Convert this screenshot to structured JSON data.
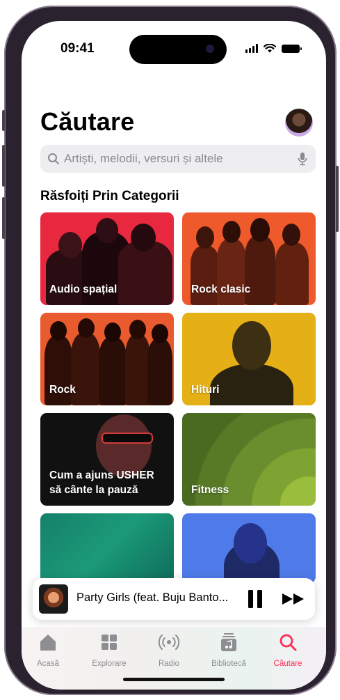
{
  "status": {
    "time": "09:41"
  },
  "header": {
    "title": "Căutare"
  },
  "search": {
    "placeholder": "Artiști, melodii, versuri și altele"
  },
  "section": {
    "title": "Răsfoiți Prin Categorii"
  },
  "categories": [
    {
      "label": "Audio spațial",
      "color": "#e8283f"
    },
    {
      "label": "Rock clasic",
      "color": "#ef5a2c"
    },
    {
      "label": "Rock",
      "color": "#e95a2e"
    },
    {
      "label": "Hituri",
      "color": "#e4b016"
    },
    {
      "label": "Cum a ajuns USHER să cânte la pauză",
      "color": "#111111"
    },
    {
      "label": "Fitness",
      "color": "#6a8d2e"
    },
    {
      "label": "",
      "color": "#1b8a6d"
    },
    {
      "label": "",
      "color": "#4f7bea"
    }
  ],
  "mini_player": {
    "song": "Party Girls (feat. Buju Banto...",
    "state": "playing"
  },
  "tabs": [
    {
      "label": "Acasă",
      "icon": "home-icon"
    },
    {
      "label": "Explorare",
      "icon": "grid-icon"
    },
    {
      "label": "Radio",
      "icon": "radio-icon"
    },
    {
      "label": "Bibliotecă",
      "icon": "library-icon"
    },
    {
      "label": "Căutare",
      "icon": "search-icon",
      "active": true
    }
  ],
  "colors": {
    "accent": "#ff2d55"
  }
}
